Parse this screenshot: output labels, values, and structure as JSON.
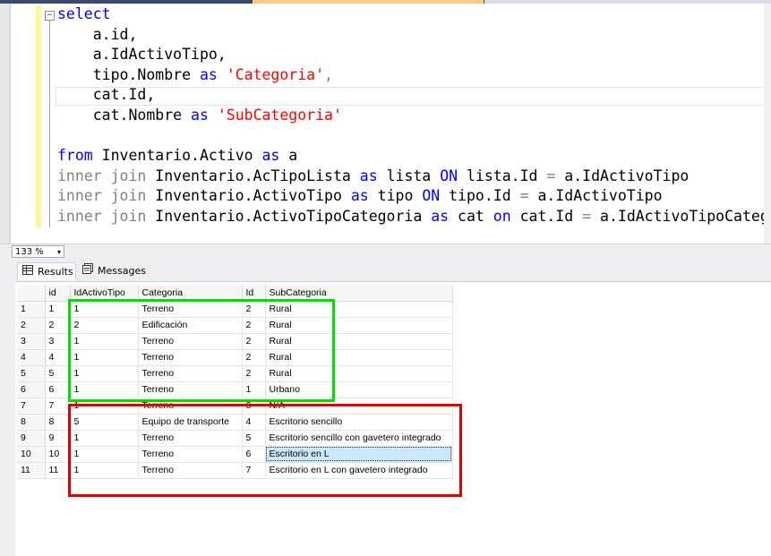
{
  "editor": {
    "lines": [
      [
        {
          "t": "select",
          "c": "kw"
        }
      ],
      [
        {
          "t": "    a.id,",
          "c": ""
        }
      ],
      [
        {
          "t": "    a.IdActivoTipo,",
          "c": ""
        }
      ],
      [
        {
          "t": "    tipo.Nombre ",
          "c": ""
        },
        {
          "t": "as",
          "c": "kw"
        },
        {
          "t": " ",
          "c": ""
        },
        {
          "t": "'Categoria'",
          "c": "str"
        },
        {
          "t": ",",
          "c": "gray"
        }
      ],
      [
        {
          "t": "    cat.Id,",
          "c": ""
        }
      ],
      [
        {
          "t": "    cat.Nombre ",
          "c": ""
        },
        {
          "t": "as",
          "c": "kw"
        },
        {
          "t": " ",
          "c": ""
        },
        {
          "t": "'SubCategoria'",
          "c": "str"
        }
      ],
      [],
      [
        {
          "t": "from",
          "c": "kw"
        },
        {
          "t": " Inventario.Activo ",
          "c": ""
        },
        {
          "t": "as",
          "c": "kw"
        },
        {
          "t": " a",
          "c": ""
        }
      ],
      [
        {
          "t": "inner join",
          "c": "gray"
        },
        {
          "t": " Inventario.AcTipoLista ",
          "c": ""
        },
        {
          "t": "as",
          "c": "kw"
        },
        {
          "t": " lista ",
          "c": ""
        },
        {
          "t": "ON",
          "c": "kw"
        },
        {
          "t": " lista.Id ",
          "c": ""
        },
        {
          "t": "=",
          "c": "gray"
        },
        {
          "t": " a.IdActivoTipo",
          "c": ""
        }
      ],
      [
        {
          "t": "inner join",
          "c": "gray"
        },
        {
          "t": " Inventario.ActivoTipo ",
          "c": ""
        },
        {
          "t": "as",
          "c": "kw"
        },
        {
          "t": " tipo ",
          "c": ""
        },
        {
          "t": "ON",
          "c": "kw"
        },
        {
          "t": " tipo.Id ",
          "c": ""
        },
        {
          "t": "=",
          "c": "gray"
        },
        {
          "t": " a.IdActivoTipo",
          "c": ""
        }
      ],
      [
        {
          "t": "inner join",
          "c": "gray"
        },
        {
          "t": " Inventario.ActivoTipoCategoria ",
          "c": ""
        },
        {
          "t": "as",
          "c": "kw"
        },
        {
          "t": " cat ",
          "c": ""
        },
        {
          "t": "on",
          "c": "kw"
        },
        {
          "t": " cat.Id ",
          "c": ""
        },
        {
          "t": "=",
          "c": "gray"
        },
        {
          "t": " a.IdActivoTipoCategoria",
          "c": ""
        }
      ]
    ],
    "outline_symbol": "−"
  },
  "zoom": {
    "value": "133 %",
    "arrow": "▾"
  },
  "tabs": {
    "results_label": "Results",
    "messages_label": "Messages"
  },
  "grid": {
    "columns": [
      "",
      "id",
      "IdActivoTipo",
      "Categoria",
      "Id",
      "SubCategoria"
    ],
    "rows": [
      [
        "1",
        "1",
        "1",
        "Terreno",
        "2",
        "Rural"
      ],
      [
        "2",
        "2",
        "2",
        "Edificación",
        "2",
        "Rural"
      ],
      [
        "3",
        "3",
        "1",
        "Terreno",
        "2",
        "Rural"
      ],
      [
        "4",
        "4",
        "1",
        "Terreno",
        "2",
        "Rural"
      ],
      [
        "5",
        "5",
        "1",
        "Terreno",
        "2",
        "Rural"
      ],
      [
        "6",
        "6",
        "1",
        "Terreno",
        "1",
        "Urbano"
      ],
      [
        "7",
        "7",
        "1",
        "Terreno",
        "3",
        "N/A"
      ],
      [
        "8",
        "8",
        "5",
        "Equipo de transporte",
        "4",
        "Escritorio sencillo"
      ],
      [
        "9",
        "9",
        "1",
        "Terreno",
        "5",
        "Escritorio sencillo con gavetero integrado"
      ],
      [
        "10",
        "10",
        "1",
        "Terreno",
        "6",
        "Escritorio en L"
      ],
      [
        "11",
        "11",
        "1",
        "Terreno",
        "7",
        "Escritorio en L con gavetero integrado"
      ]
    ],
    "selected_row": 9,
    "selected_col": 5
  },
  "colors": {
    "green_highlight": "#00e000",
    "red_highlight": "#e00000",
    "keyword": "#0000ff",
    "string": "#ff0000",
    "operator": "#808080"
  }
}
